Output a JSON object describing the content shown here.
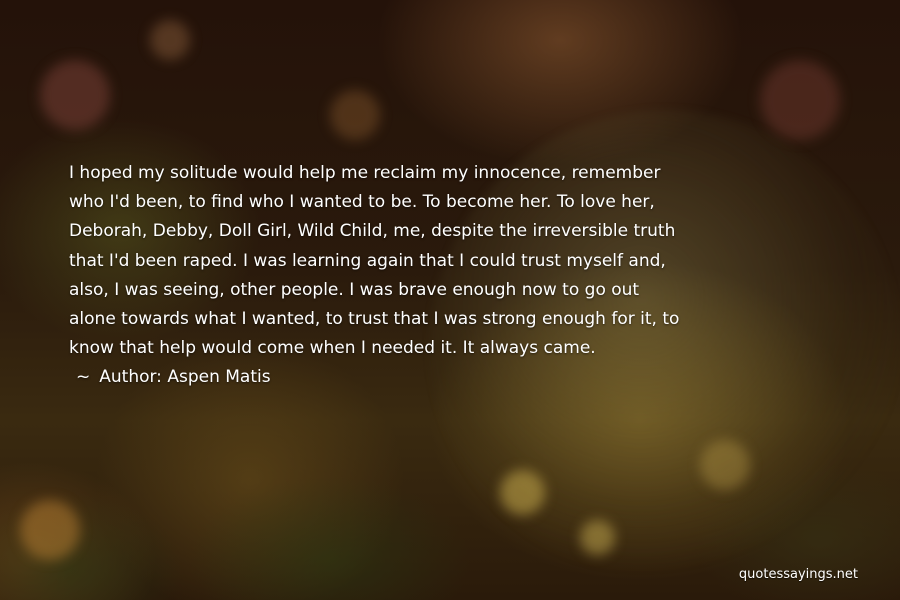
{
  "quote": {
    "lines": [
      "I hoped my solitude would help me reclaim my innocence, remember",
      "who I'd been, to find who I wanted to be. To become her. To love her,",
      "Deborah, Debby, Doll Girl, Wild Child, me, despite the irreversible truth",
      "that I'd been raped. I was learning again that I could trust myself and,",
      "also, I was seeing, other people. I was brave enough now to go out",
      "alone towards what I wanted, to trust that I was strong enough for it, to",
      "know that help would come when I needed it. It always came."
    ]
  },
  "author": {
    "tilde": "~",
    "prefix": "Author:",
    "name": "Aspen Matis"
  },
  "watermark": "quotessayings.net",
  "colors": {
    "text": "#ffffff",
    "background": "#2a1a0c"
  }
}
